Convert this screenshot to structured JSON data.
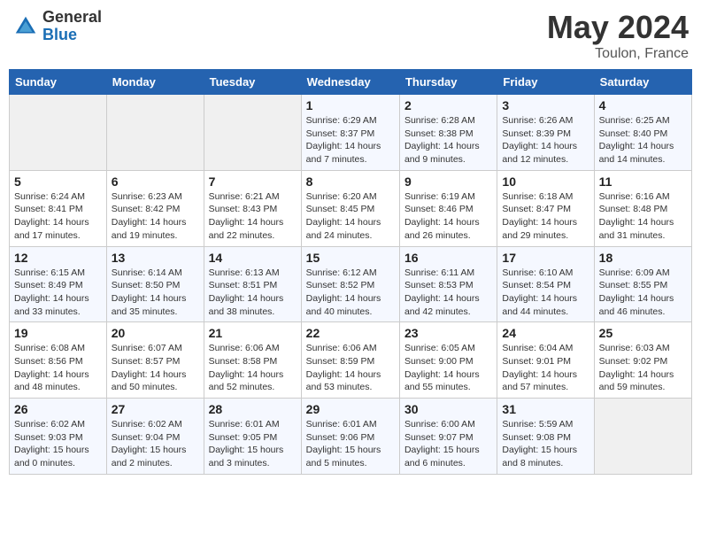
{
  "header": {
    "logo_line1": "General",
    "logo_line2": "Blue",
    "month": "May 2024",
    "location": "Toulon, France"
  },
  "weekdays": [
    "Sunday",
    "Monday",
    "Tuesday",
    "Wednesday",
    "Thursday",
    "Friday",
    "Saturday"
  ],
  "weeks": [
    [
      null,
      null,
      null,
      {
        "day": "1",
        "sunrise": "Sunrise: 6:29 AM",
        "sunset": "Sunset: 8:37 PM",
        "daylight": "Daylight: 14 hours and 7 minutes."
      },
      {
        "day": "2",
        "sunrise": "Sunrise: 6:28 AM",
        "sunset": "Sunset: 8:38 PM",
        "daylight": "Daylight: 14 hours and 9 minutes."
      },
      {
        "day": "3",
        "sunrise": "Sunrise: 6:26 AM",
        "sunset": "Sunset: 8:39 PM",
        "daylight": "Daylight: 14 hours and 12 minutes."
      },
      {
        "day": "4",
        "sunrise": "Sunrise: 6:25 AM",
        "sunset": "Sunset: 8:40 PM",
        "daylight": "Daylight: 14 hours and 14 minutes."
      }
    ],
    [
      {
        "day": "5",
        "sunrise": "Sunrise: 6:24 AM",
        "sunset": "Sunset: 8:41 PM",
        "daylight": "Daylight: 14 hours and 17 minutes."
      },
      {
        "day": "6",
        "sunrise": "Sunrise: 6:23 AM",
        "sunset": "Sunset: 8:42 PM",
        "daylight": "Daylight: 14 hours and 19 minutes."
      },
      {
        "day": "7",
        "sunrise": "Sunrise: 6:21 AM",
        "sunset": "Sunset: 8:43 PM",
        "daylight": "Daylight: 14 hours and 22 minutes."
      },
      {
        "day": "8",
        "sunrise": "Sunrise: 6:20 AM",
        "sunset": "Sunset: 8:45 PM",
        "daylight": "Daylight: 14 hours and 24 minutes."
      },
      {
        "day": "9",
        "sunrise": "Sunrise: 6:19 AM",
        "sunset": "Sunset: 8:46 PM",
        "daylight": "Daylight: 14 hours and 26 minutes."
      },
      {
        "day": "10",
        "sunrise": "Sunrise: 6:18 AM",
        "sunset": "Sunset: 8:47 PM",
        "daylight": "Daylight: 14 hours and 29 minutes."
      },
      {
        "day": "11",
        "sunrise": "Sunrise: 6:16 AM",
        "sunset": "Sunset: 8:48 PM",
        "daylight": "Daylight: 14 hours and 31 minutes."
      }
    ],
    [
      {
        "day": "12",
        "sunrise": "Sunrise: 6:15 AM",
        "sunset": "Sunset: 8:49 PM",
        "daylight": "Daylight: 14 hours and 33 minutes."
      },
      {
        "day": "13",
        "sunrise": "Sunrise: 6:14 AM",
        "sunset": "Sunset: 8:50 PM",
        "daylight": "Daylight: 14 hours and 35 minutes."
      },
      {
        "day": "14",
        "sunrise": "Sunrise: 6:13 AM",
        "sunset": "Sunset: 8:51 PM",
        "daylight": "Daylight: 14 hours and 38 minutes."
      },
      {
        "day": "15",
        "sunrise": "Sunrise: 6:12 AM",
        "sunset": "Sunset: 8:52 PM",
        "daylight": "Daylight: 14 hours and 40 minutes."
      },
      {
        "day": "16",
        "sunrise": "Sunrise: 6:11 AM",
        "sunset": "Sunset: 8:53 PM",
        "daylight": "Daylight: 14 hours and 42 minutes."
      },
      {
        "day": "17",
        "sunrise": "Sunrise: 6:10 AM",
        "sunset": "Sunset: 8:54 PM",
        "daylight": "Daylight: 14 hours and 44 minutes."
      },
      {
        "day": "18",
        "sunrise": "Sunrise: 6:09 AM",
        "sunset": "Sunset: 8:55 PM",
        "daylight": "Daylight: 14 hours and 46 minutes."
      }
    ],
    [
      {
        "day": "19",
        "sunrise": "Sunrise: 6:08 AM",
        "sunset": "Sunset: 8:56 PM",
        "daylight": "Daylight: 14 hours and 48 minutes."
      },
      {
        "day": "20",
        "sunrise": "Sunrise: 6:07 AM",
        "sunset": "Sunset: 8:57 PM",
        "daylight": "Daylight: 14 hours and 50 minutes."
      },
      {
        "day": "21",
        "sunrise": "Sunrise: 6:06 AM",
        "sunset": "Sunset: 8:58 PM",
        "daylight": "Daylight: 14 hours and 52 minutes."
      },
      {
        "day": "22",
        "sunrise": "Sunrise: 6:06 AM",
        "sunset": "Sunset: 8:59 PM",
        "daylight": "Daylight: 14 hours and 53 minutes."
      },
      {
        "day": "23",
        "sunrise": "Sunrise: 6:05 AM",
        "sunset": "Sunset: 9:00 PM",
        "daylight": "Daylight: 14 hours and 55 minutes."
      },
      {
        "day": "24",
        "sunrise": "Sunrise: 6:04 AM",
        "sunset": "Sunset: 9:01 PM",
        "daylight": "Daylight: 14 hours and 57 minutes."
      },
      {
        "day": "25",
        "sunrise": "Sunrise: 6:03 AM",
        "sunset": "Sunset: 9:02 PM",
        "daylight": "Daylight: 14 hours and 59 minutes."
      }
    ],
    [
      {
        "day": "26",
        "sunrise": "Sunrise: 6:02 AM",
        "sunset": "Sunset: 9:03 PM",
        "daylight": "Daylight: 15 hours and 0 minutes."
      },
      {
        "day": "27",
        "sunrise": "Sunrise: 6:02 AM",
        "sunset": "Sunset: 9:04 PM",
        "daylight": "Daylight: 15 hours and 2 minutes."
      },
      {
        "day": "28",
        "sunrise": "Sunrise: 6:01 AM",
        "sunset": "Sunset: 9:05 PM",
        "daylight": "Daylight: 15 hours and 3 minutes."
      },
      {
        "day": "29",
        "sunrise": "Sunrise: 6:01 AM",
        "sunset": "Sunset: 9:06 PM",
        "daylight": "Daylight: 15 hours and 5 minutes."
      },
      {
        "day": "30",
        "sunrise": "Sunrise: 6:00 AM",
        "sunset": "Sunset: 9:07 PM",
        "daylight": "Daylight: 15 hours and 6 minutes."
      },
      {
        "day": "31",
        "sunrise": "Sunrise: 5:59 AM",
        "sunset": "Sunset: 9:08 PM",
        "daylight": "Daylight: 15 hours and 8 minutes."
      },
      null
    ]
  ]
}
